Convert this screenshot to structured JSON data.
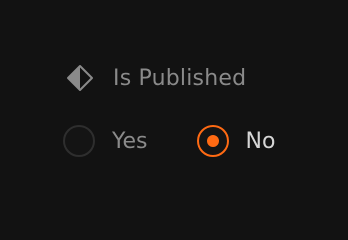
{
  "field": {
    "label": "Is Published",
    "icon": "diamond-half-icon"
  },
  "options": [
    {
      "label": "Yes",
      "selected": false
    },
    {
      "label": "No",
      "selected": true
    }
  ],
  "colors": {
    "background": "#121212",
    "accent": "#ff6a13",
    "label": "#8a8a8a",
    "selected_text": "#d6d6d6"
  }
}
